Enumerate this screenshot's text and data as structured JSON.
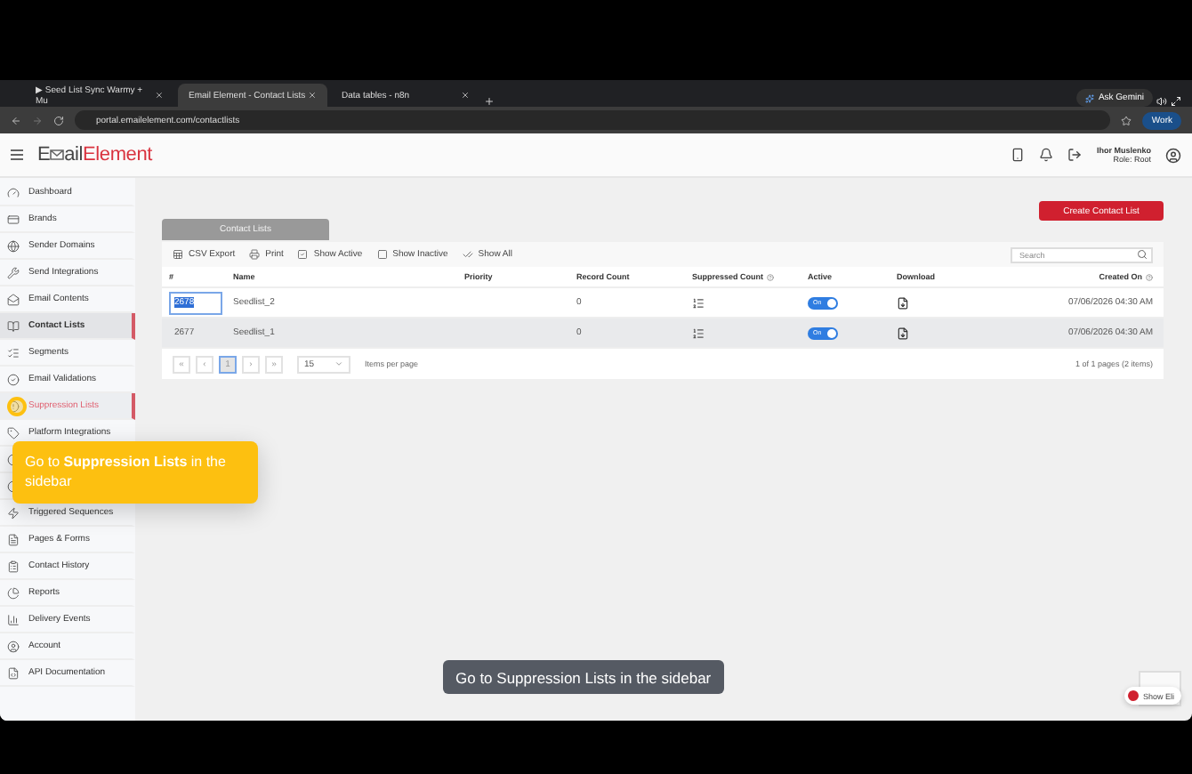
{
  "browser": {
    "tabs": [
      {
        "title": "▶ Seed List Sync Warmy + Mu",
        "selected": false
      },
      {
        "title": "Email Element - Contact Lists",
        "selected": true
      },
      {
        "title": "Data tables - n8n",
        "selected": false
      }
    ],
    "gemini": "Ask Gemini",
    "url": "portal.emailelement.com/contactlists",
    "profile": "Work"
  },
  "header": {
    "logo_left": "E",
    "logo_mid": "ail",
    "logo_right": "Element",
    "user_name": "Ihor Muslenko",
    "user_role": "Role: Root"
  },
  "sidebar": {
    "items": [
      {
        "label": "Dashboard",
        "selected": false,
        "hovered": false
      },
      {
        "label": "Brands",
        "selected": false,
        "hovered": false
      },
      {
        "label": "Sender Domains",
        "selected": false,
        "hovered": false
      },
      {
        "label": "Send Integrations",
        "selected": false,
        "hovered": false
      },
      {
        "label": "Email Contents",
        "selected": false,
        "hovered": false
      },
      {
        "label": "Contact Lists",
        "selected": true,
        "hovered": false
      },
      {
        "label": "Segments",
        "selected": false,
        "hovered": false
      },
      {
        "label": "Email Validations",
        "selected": false,
        "hovered": false
      },
      {
        "label": "Suppression Lists",
        "selected": false,
        "hovered": true
      },
      {
        "label": "Platform Integrations",
        "selected": false,
        "hovered": false
      },
      {
        "selected": false,
        "hovered": false
      },
      {
        "selected": false,
        "hovered": false
      },
      {
        "label": "Triggered Sequences",
        "selected": false,
        "hovered": false
      },
      {
        "label": "Pages & Forms",
        "selected": false,
        "hovered": false
      },
      {
        "label": "Contact History",
        "selected": false,
        "hovered": false
      },
      {
        "label": "Reports",
        "selected": false,
        "hovered": false
      },
      {
        "label": "Delivery Events",
        "selected": false,
        "hovered": false
      },
      {
        "label": "Account",
        "selected": false,
        "hovered": false
      },
      {
        "label": "API Documentation",
        "selected": false,
        "hovered": false
      }
    ]
  },
  "panel_title": "Contact Lists",
  "create_button": "Create Contact List",
  "toolbar": [
    "CSV Export",
    "Print",
    "Show Active",
    "Show Inactive",
    "Show All"
  ],
  "search": {
    "placeholder": "Search"
  },
  "table": {
    "columns": [
      "#",
      "Name",
      "Priority",
      "Record Count",
      "Suppressed Count",
      "Active",
      "Download",
      "Created On"
    ],
    "rows": [
      {
        "id": "2678",
        "name": "Seedlist_2",
        "record_count": "0",
        "active": {
          "on": true,
          "label": "On"
        },
        "created_on": "07/06/2026 04:30 AM",
        "focused": true,
        "selected": false
      },
      {
        "id": "2677",
        "name": "Seedlist_1",
        "record_count": "0",
        "active": {
          "on": true,
          "label": "On"
        },
        "created_on": "07/06/2026 04:30 AM",
        "focused": false,
        "selected": true
      }
    ]
  },
  "pager": {
    "first": "«",
    "prev": "‹",
    "pages": [
      {
        "label": "1",
        "selected": true
      }
    ],
    "next": "›",
    "last": "»",
    "page_size": "15",
    "page_size_label": "Items per page",
    "summary": "1 of 1 pages (2 items)"
  },
  "tooltip": "Go to **Suppression Lists** in the sidebar",
  "caption": "Go to Suppression Lists in the sidebar",
  "widget": "Show Eli"
}
